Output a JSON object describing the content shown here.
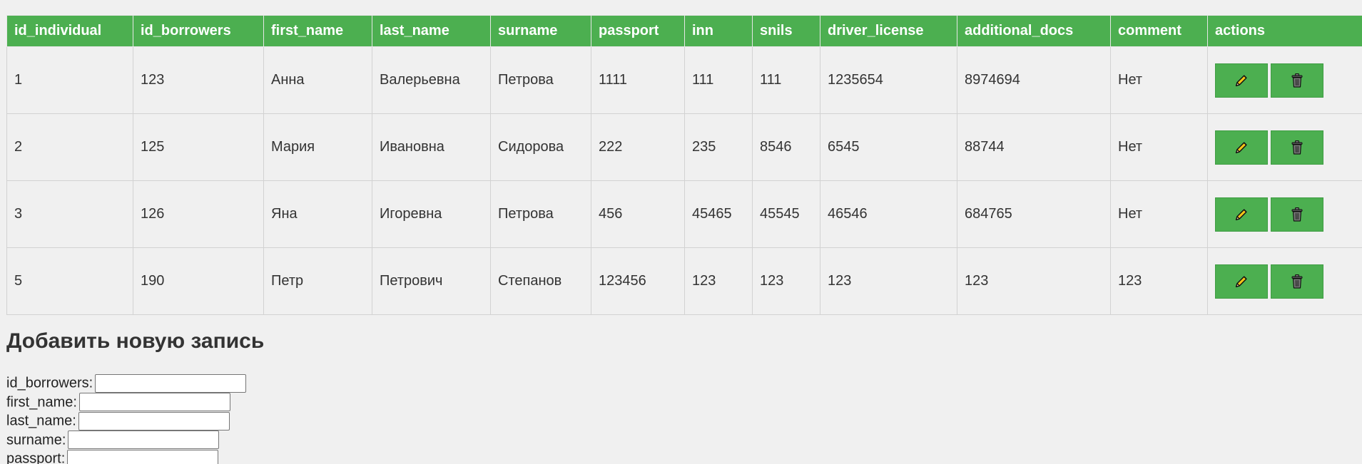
{
  "table": {
    "columns": [
      "id_individual",
      "id_borrowers",
      "first_name",
      "last_name",
      "surname",
      "passport",
      "inn",
      "snils",
      "driver_license",
      "additional_docs",
      "comment",
      "actions"
    ],
    "rows": [
      [
        "1",
        "123",
        "Анна",
        "Валерьевна",
        "Петрова",
        "1111",
        "111",
        "111",
        "1235654",
        "8974694",
        "Нет"
      ],
      [
        "2",
        "125",
        "Мария",
        "Ивановна",
        "Сидорова",
        "222",
        "235",
        "8546",
        "6545",
        "88744",
        "Нет"
      ],
      [
        "3",
        "126",
        "Яна",
        "Игоревна",
        "Петрова",
        "456",
        "45465",
        "45545",
        "46546",
        "684765",
        "Нет"
      ],
      [
        "5",
        "190",
        "Петр",
        "Петрович",
        "Степанов",
        "123456",
        "123",
        "123",
        "123",
        "123",
        "123"
      ]
    ],
    "edit_icon": "pencil-icon",
    "delete_icon": "trash-icon",
    "header_color": "#4caf50"
  },
  "form": {
    "title": "Добавить новую запись",
    "fields": [
      {
        "label": "id_borrowers:",
        "value": "",
        "placeholder": ""
      },
      {
        "label": "first_name:",
        "value": "",
        "placeholder": ""
      },
      {
        "label": "last_name:",
        "value": "",
        "placeholder": ""
      },
      {
        "label": "surname:",
        "value": "",
        "placeholder": ""
      },
      {
        "label": "passport:",
        "value": "",
        "placeholder": ""
      }
    ]
  }
}
